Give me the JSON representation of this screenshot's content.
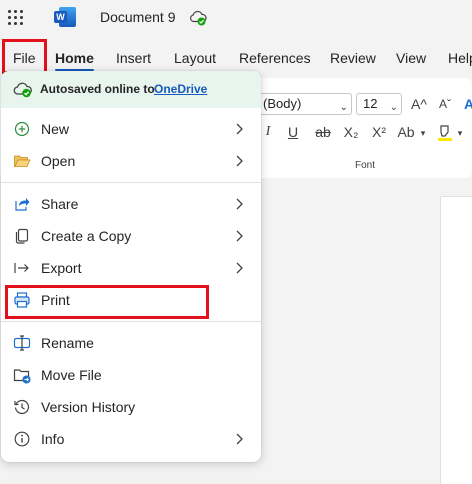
{
  "titlebar": {
    "app_letter": "W",
    "document_title": "Document 9"
  },
  "tabs": [
    {
      "label": "File"
    },
    {
      "label": "Home"
    },
    {
      "label": "Insert"
    },
    {
      "label": "Layout"
    },
    {
      "label": "References"
    },
    {
      "label": "Review"
    },
    {
      "label": "View"
    },
    {
      "label": "Help"
    }
  ],
  "ribbon": {
    "font_name": "(Body)",
    "font_size": "12",
    "grow_font": "A^",
    "shrink_font": "Aˇ",
    "italic": "I",
    "underline": "U",
    "strikethrough": "ab",
    "subscript": "X₂",
    "superscript": "X²",
    "change_case": "Ab",
    "font_group_label": "Font"
  },
  "file_menu": {
    "autosave_text": "Autosaved online to",
    "autosave_link": "OneDrive",
    "items": [
      {
        "label": "New",
        "icon": "plus-circle-icon",
        "submenu": true
      },
      {
        "label": "Open",
        "icon": "folder-open-icon",
        "submenu": true
      },
      {
        "label": "Share",
        "icon": "share-icon",
        "submenu": true
      },
      {
        "label": "Create a Copy",
        "icon": "copy-icon",
        "submenu": true
      },
      {
        "label": "Export",
        "icon": "export-arrow-icon",
        "submenu": true
      },
      {
        "label": "Print",
        "icon": "printer-icon",
        "submenu": false
      },
      {
        "label": "Rename",
        "icon": "rename-icon",
        "submenu": false
      },
      {
        "label": "Move File",
        "icon": "move-folder-icon",
        "submenu": false
      },
      {
        "label": "Version History",
        "icon": "history-icon",
        "submenu": false
      },
      {
        "label": "Info",
        "icon": "info-icon",
        "submenu": true
      }
    ]
  },
  "colors": {
    "highlight_red": "#e3111b",
    "word_blue": "#185abd",
    "link_blue": "#185abd",
    "autosave_bg": "#e8f4ee",
    "saved_green": "#13a10e"
  }
}
